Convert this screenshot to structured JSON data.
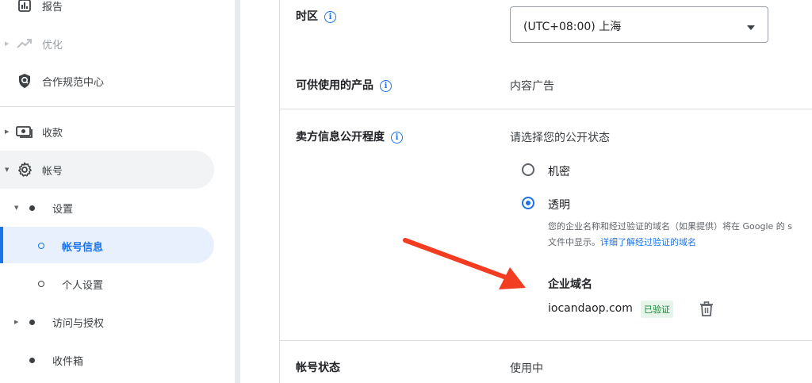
{
  "sidebar": {
    "items": [
      {
        "label": "报告",
        "icon": "bar-chart-icon"
      },
      {
        "label": "优化",
        "icon": "trending-up-icon"
      },
      {
        "label": "合作规范中心",
        "icon": "policy-shield-icon"
      },
      {
        "label": "收款",
        "icon": "payments-icon"
      },
      {
        "label": "帐号",
        "icon": "gear-icon"
      },
      {
        "label": "设置"
      },
      {
        "label": "帐号信息"
      },
      {
        "label": "个人设置"
      },
      {
        "label": "访问与授权"
      },
      {
        "label": "收件箱"
      }
    ]
  },
  "main": {
    "timezone": {
      "label": "时区",
      "value": "(UTC+08:00) 上海"
    },
    "products": {
      "label": "可供使用的产品",
      "value": "内容广告"
    },
    "seller_info": {
      "label": "卖方信息公开程度",
      "prompt": "请选择您的公开状态",
      "options": [
        {
          "label": "机密",
          "checked": false
        },
        {
          "label": "透明",
          "checked": true
        }
      ],
      "description_line1": "您的企业名称和经过验证的域名（如果提供）将在 Google 的 s",
      "description_line2": "文件中显示。",
      "learn_more": "详细了解经过验证的域名",
      "domain_heading": "企业域名",
      "domain": "iocandaop.com",
      "verified_badge": "已验证"
    },
    "account_status": {
      "label": "帐号状态",
      "value": "使用中"
    }
  },
  "colors": {
    "accent": "#1a73e8",
    "arrow": "#f23d22",
    "verified_bg": "#e6f4ea",
    "verified_text": "#188038"
  }
}
